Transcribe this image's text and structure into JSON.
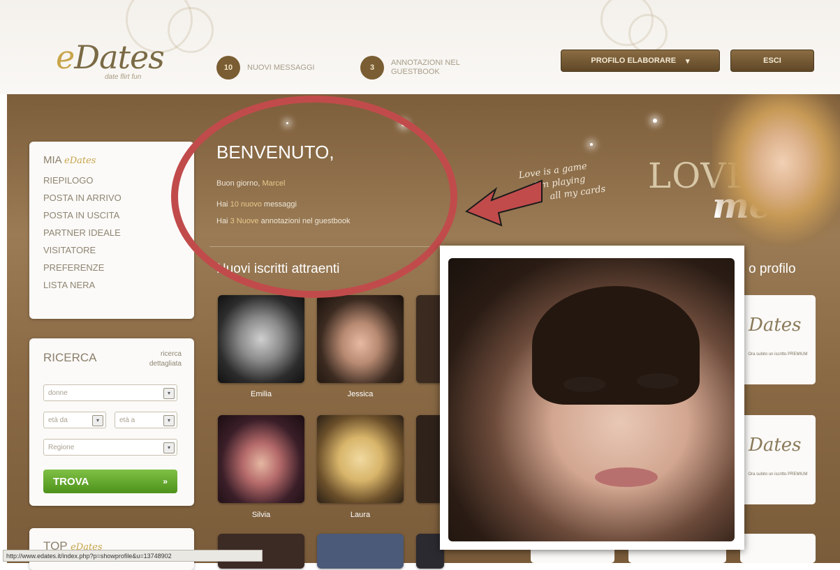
{
  "header": {
    "logo_main": "Dates",
    "logo_e": "e",
    "logo_tagline": "date flirt fun",
    "messages_count": "10",
    "messages_label": "NUOVI MESSAGGI",
    "guestbook_count": "3",
    "guestbook_label_1": "ANNOTAZIONI NEL",
    "guestbook_label_2": "GUESTBOOK",
    "profile_button": "PROFILO  ELABORARE",
    "profile_arrow": "▾",
    "exit_button": "ESCI"
  },
  "sidebar": {
    "mia_label": "MIA",
    "mia_brand": "eDates",
    "items": [
      "RIEPILOGO",
      "POSTA IN ARRIVO",
      "POSTA IN USCITA",
      "PARTNER IDEALE",
      "VISITATORE",
      "PREFERENZE",
      "LISTA NERA"
    ]
  },
  "search": {
    "title": "RICERCA",
    "detail_link_1": "ricerca",
    "detail_link_2": "dettagliata",
    "gender_select": "donne",
    "age_from": "età da",
    "age_to": "età a",
    "region_select": "Regione",
    "find_button": "TROVA",
    "find_arrow": "»"
  },
  "top_section": {
    "title_1": "TOP",
    "title_brand": "eDates"
  },
  "welcome": {
    "title": "BENVENUTO,",
    "greeting": "Buon giorno,",
    "username": "Marcel",
    "messages_prefix": "Hai",
    "messages_highlight": "10 nuovo",
    "messages_suffix": "messaggi",
    "guestbook_prefix": "Hai",
    "guestbook_highlight": "3 Nuove",
    "guestbook_suffix": "annotazioni nel guestbook"
  },
  "banner": {
    "script_text_1": "Love is a game",
    "script_text_2": "I'm playing",
    "script_text_3": "all my cards",
    "love_text": "LOVE",
    "me_text": "me"
  },
  "new_members": {
    "title": "Nuovi iscritti attraenti",
    "right_title": "o profilo",
    "members": [
      "Emilia",
      "Jessica",
      "",
      "Silvia",
      "Laura",
      ""
    ]
  },
  "ads": {
    "logo": "Dates",
    "tagline": "date flirt fun",
    "text": "Ora subito un iscritto PREMIUM"
  },
  "statusbar": {
    "url": "http://www.edates.it/index.php?p=showprofile&u=13748902"
  },
  "colors": {
    "brown_dark": "#5f4727",
    "brown_bg": "#8a6a45",
    "gold": "#c8a54a",
    "green_button": "#5ea527",
    "annotation_red": "#c14b4b"
  }
}
